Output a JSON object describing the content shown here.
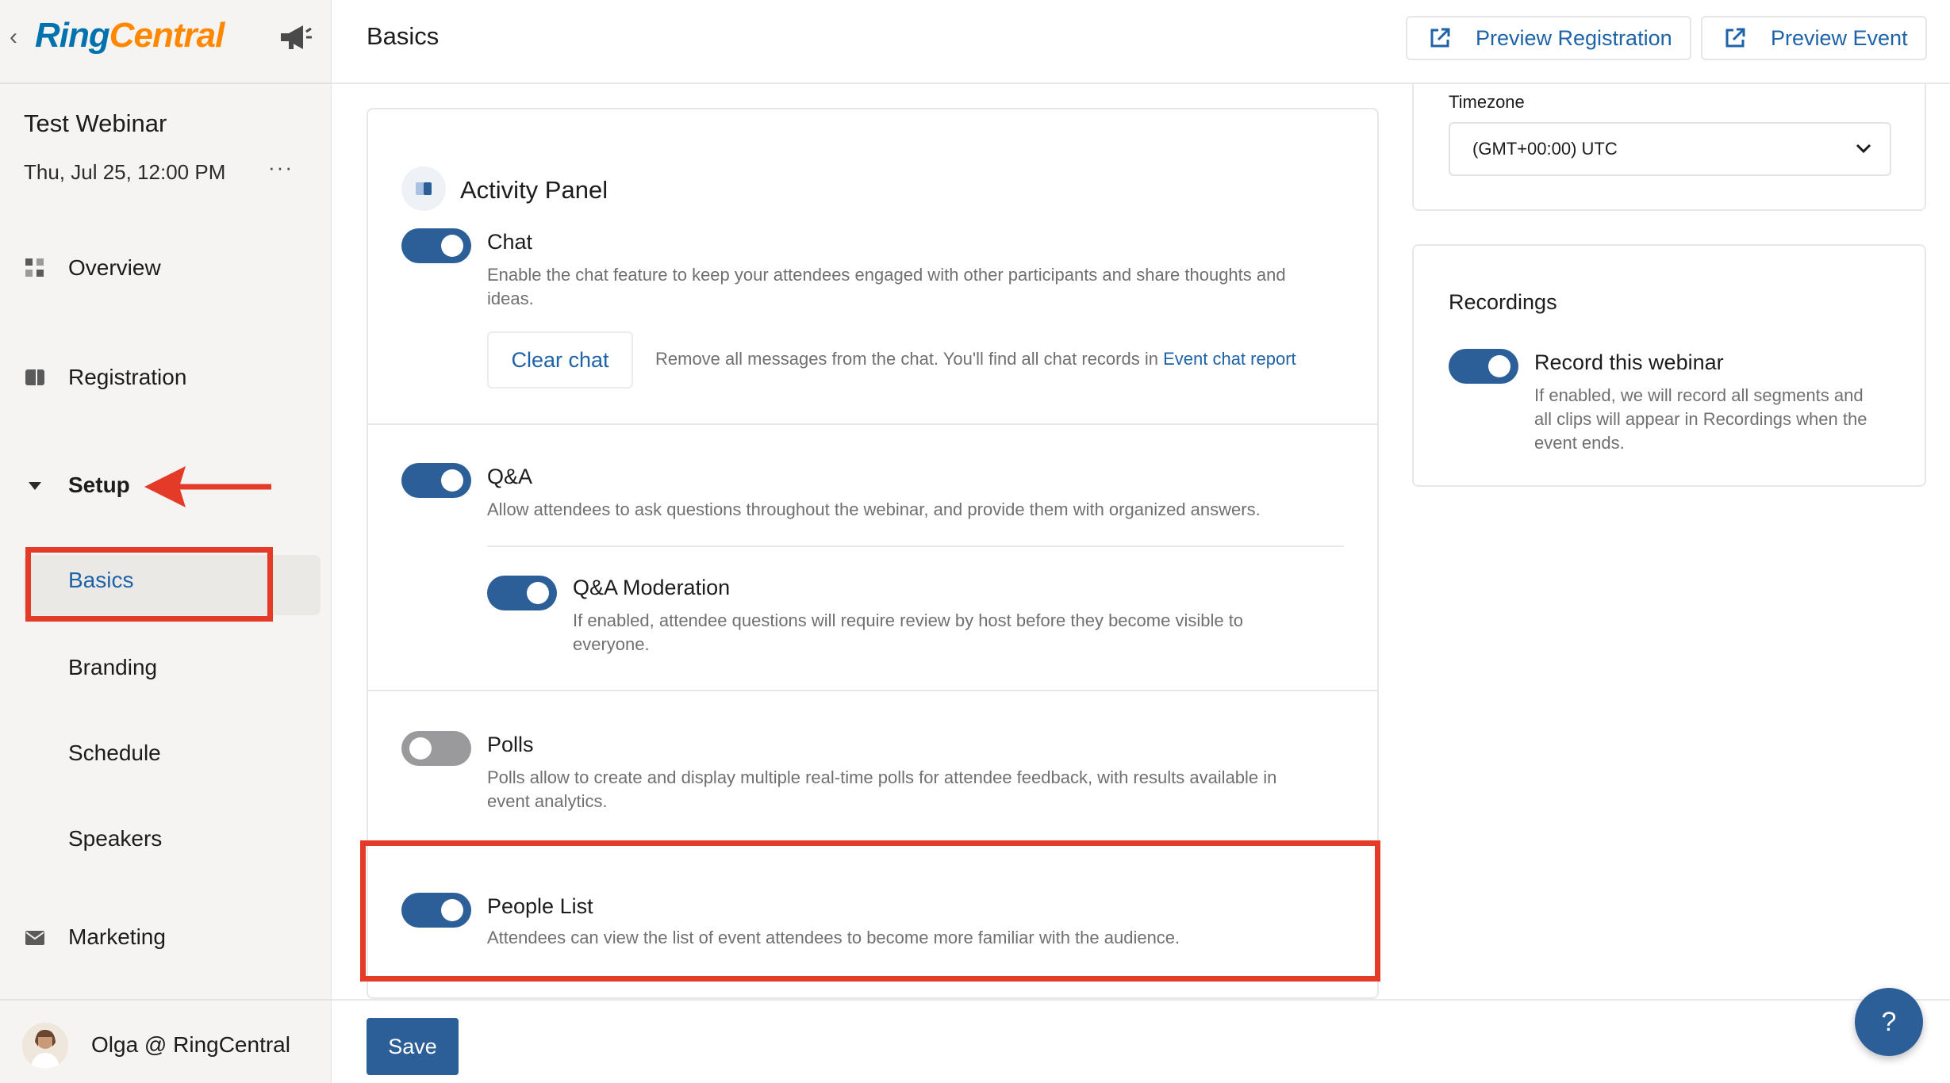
{
  "sidebar": {
    "back_glyph": "‹",
    "logo_ring": "Ring",
    "logo_central": "Central",
    "event_title": "Test Webinar",
    "event_date": "Thu, Jul 25, 12:00 PM",
    "more_glyph": "···",
    "nav": {
      "overview": "Overview",
      "registration": "Registration",
      "setup": "Setup",
      "basics": "Basics",
      "branding": "Branding",
      "schedule": "Schedule",
      "speakers": "Speakers",
      "marketing": "Marketing"
    },
    "user_name": "Olga @ RingCentral"
  },
  "header": {
    "title": "Basics",
    "preview_registration": "Preview Registration",
    "preview_event": "Preview Event"
  },
  "activity_panel": {
    "title": "Activity Panel",
    "chat": {
      "label": "Chat",
      "enabled": true,
      "desc_line1": "Enable the chat feature to keep your attendees engaged with other participants and share thoughts and",
      "desc_line2": "ideas.",
      "clear_button": "Clear chat",
      "clear_note": "Remove all messages from the chat. You'll find all chat records in",
      "report_link": "Event chat report"
    },
    "qa": {
      "label": "Q&A",
      "enabled": true,
      "desc": "Allow attendees to ask questions throughout the webinar, and provide them with organized answers."
    },
    "qa_moderation": {
      "label": "Q&A Moderation",
      "enabled": true,
      "desc_line1": "If enabled, attendee questions will require review by host before they become visible to",
      "desc_line2": "everyone."
    },
    "polls": {
      "label": "Polls",
      "enabled": false,
      "desc_line1": "Polls allow to create and display multiple real-time polls for attendee feedback, with results available in",
      "desc_line2": "event analytics."
    },
    "people_list": {
      "label": "People List",
      "enabled": true,
      "desc": "Attendees can view the list of event attendees to become more familiar with the audience."
    }
  },
  "timezone": {
    "label": "Timezone",
    "value": "(GMT+00:00) UTC"
  },
  "recordings": {
    "title": "Recordings",
    "toggle_label": "Record this webinar",
    "enabled": true,
    "desc_line1": "If enabled, we will record all segments and",
    "desc_line2": "all clips will appear in Recordings when the",
    "desc_line3": "event ends."
  },
  "footer": {
    "save": "Save",
    "help": "?"
  },
  "colors": {
    "accent": "#2c5e98",
    "link": "#1e62a8",
    "highlight": "#e43a28"
  }
}
